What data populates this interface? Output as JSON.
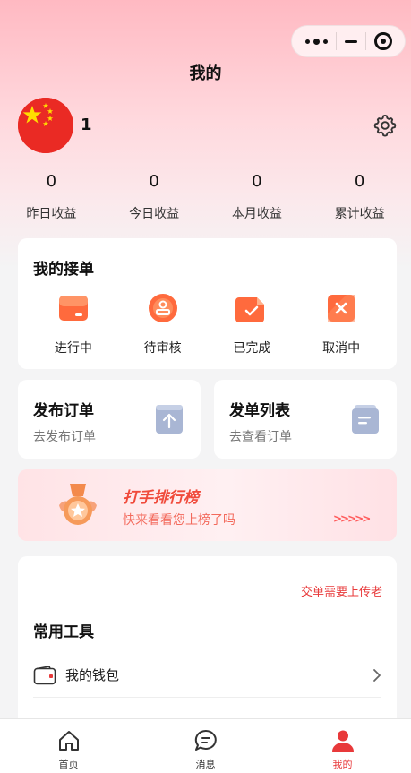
{
  "page": {
    "title": "我的"
  },
  "profile": {
    "name": "1",
    "avatar": "china-flag"
  },
  "stats": [
    {
      "value": "0",
      "label": "昨日收益"
    },
    {
      "value": "0",
      "label": "今日收益"
    },
    {
      "value": "0",
      "label": "本月收益"
    },
    {
      "value": "0",
      "label": "累计收益"
    }
  ],
  "orders": {
    "title": "我的接单",
    "items": [
      {
        "label": "进行中",
        "icon": "in-progress-icon"
      },
      {
        "label": "待审核",
        "icon": "pending-review-icon"
      },
      {
        "label": "已完成",
        "icon": "completed-icon"
      },
      {
        "label": "取消中",
        "icon": "cancelling-icon"
      }
    ]
  },
  "publish": {
    "title": "发布订单",
    "subtitle": "去发布订单"
  },
  "order_list": {
    "title": "发单列表",
    "subtitle": "去查看订单"
  },
  "ranking": {
    "title": "打手排行榜",
    "subtitle": "快来看看您上榜了吗",
    "arrows": ">>>>>"
  },
  "tools": {
    "note": "交单需要上传老",
    "title": "常用工具",
    "items": [
      {
        "label": "我的钱包"
      }
    ]
  },
  "tabbar": [
    {
      "label": "首页",
      "icon": "home-icon"
    },
    {
      "label": "消息",
      "icon": "message-icon"
    },
    {
      "label": "我的",
      "icon": "profile-icon",
      "active": true
    }
  ],
  "colors": {
    "accent": "#e8393a",
    "orange": "#ff6a3d",
    "hero_top": "#ffb9c2"
  }
}
